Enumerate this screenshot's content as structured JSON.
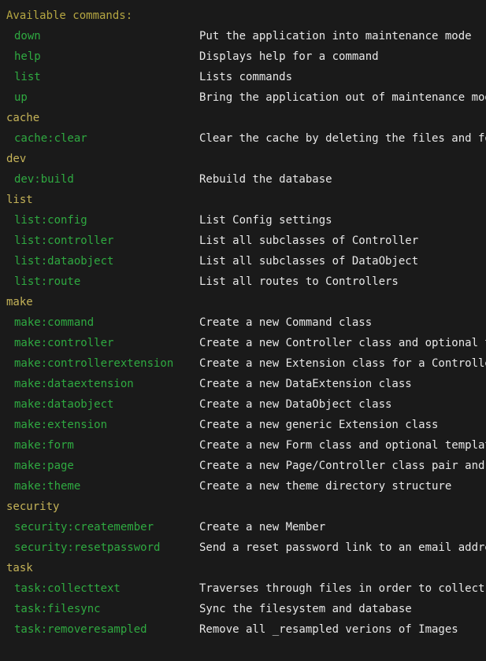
{
  "terminal": {
    "background_color": "#1a1a1a",
    "title_color": "#b5a642",
    "section_color": "#c5b358",
    "command_color": "#2faa41",
    "description_color": "#e8e8e8",
    "heading": "Available commands:"
  },
  "groups": [
    {
      "name": "",
      "header": null,
      "commands": [
        {
          "name": "down",
          "description": "Put the application into maintenance mode"
        },
        {
          "name": "help",
          "description": "Displays help for a command"
        },
        {
          "name": "list",
          "description": "Lists commands"
        },
        {
          "name": "up",
          "description": "Bring the application out of maintenance mode"
        }
      ]
    },
    {
      "name": "cache",
      "header": "cache",
      "commands": [
        {
          "name": "cache:clear",
          "description": "Clear the cache by deleting the files and folders"
        }
      ]
    },
    {
      "name": "dev",
      "header": "dev",
      "commands": [
        {
          "name": "dev:build",
          "description": "Rebuild the database"
        }
      ]
    },
    {
      "name": "list",
      "header": "list",
      "commands": [
        {
          "name": "list:config",
          "description": "List Config settings"
        },
        {
          "name": "list:controller",
          "description": "List all subclasses of Controller"
        },
        {
          "name": "list:dataobject",
          "description": "List all subclasses of DataObject"
        },
        {
          "name": "list:route",
          "description": "List all routes to Controllers"
        }
      ]
    },
    {
      "name": "make",
      "header": "make",
      "commands": [
        {
          "name": "make:command",
          "description": "Create a new Command class"
        },
        {
          "name": "make:controller",
          "description": "Create a new Controller class and optional template"
        },
        {
          "name": "make:controllerextension",
          "description": "Create a new Extension class for a Controller"
        },
        {
          "name": "make:dataextension",
          "description": "Create a new DataExtension class"
        },
        {
          "name": "make:dataobject",
          "description": "Create a new DataObject class"
        },
        {
          "name": "make:extension",
          "description": "Create a new generic Extension class"
        },
        {
          "name": "make:form",
          "description": "Create a new Form class and optional template"
        },
        {
          "name": "make:page",
          "description": "Create a new Page/Controller class pair and template"
        },
        {
          "name": "make:theme",
          "description": "Create a new theme directory structure"
        }
      ]
    },
    {
      "name": "security",
      "header": "security",
      "commands": [
        {
          "name": "security:createmember",
          "description": "Create a new Member"
        },
        {
          "name": "security:resetpassword",
          "description": "Send a reset password link to an email address"
        }
      ]
    },
    {
      "name": "task",
      "header": "task",
      "commands": [
        {
          "name": "task:collecttext",
          "description": "Traverses through files in order to collect text"
        },
        {
          "name": "task:filesync",
          "description": "Sync the filesystem and database"
        },
        {
          "name": "task:removeresampled",
          "description": "Remove all _resampled verions of Images"
        }
      ]
    }
  ]
}
